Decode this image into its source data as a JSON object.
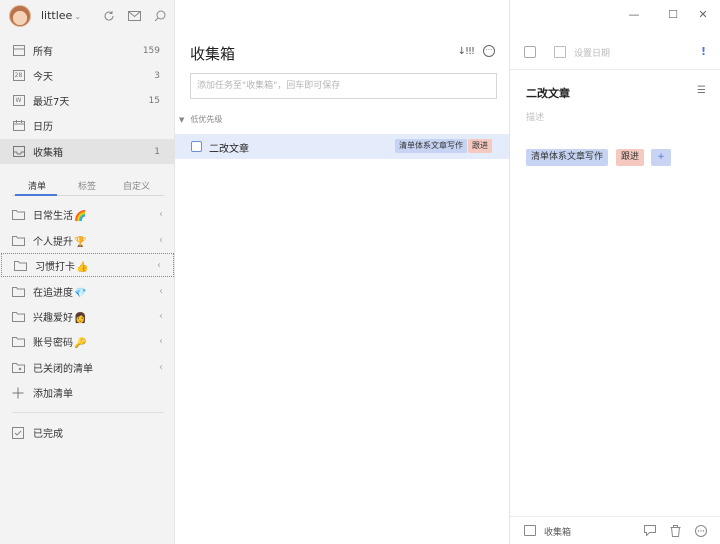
{
  "user": {
    "name": "littlee",
    "caret": "⌄"
  },
  "sidebar": {
    "nav": [
      {
        "label": "所有",
        "count": "159",
        "icon": "inbox-tray-icon"
      },
      {
        "label": "今天",
        "count": "3",
        "icon": "calendar-28-icon",
        "icon_text": "28"
      },
      {
        "label": "最近7天",
        "count": "15",
        "icon": "calendar-week-icon",
        "icon_text": "W"
      },
      {
        "label": "日历",
        "count": "",
        "icon": "calendar-icon"
      },
      {
        "label": "收集箱",
        "count": "1",
        "icon": "inbox-icon",
        "active": true
      }
    ],
    "tabs": [
      "清单",
      "标签",
      "自定义"
    ],
    "lists": [
      {
        "label": "日常生活",
        "emoji": "🌈"
      },
      {
        "label": "个人提升",
        "emoji": "🏆"
      },
      {
        "label": "习惯打卡",
        "emoji": "👍"
      },
      {
        "label": "在追进度",
        "emoji": "💎"
      },
      {
        "label": "兴趣爱好",
        "emoji": "👩"
      },
      {
        "label": "账号密码",
        "emoji": "🔑"
      }
    ],
    "closed_lists": "已关闭的清单",
    "add_list": "添加清单",
    "completed": "已完成",
    "chevron": "‹"
  },
  "middle": {
    "title": "收集箱",
    "sort_label": "↓!!!",
    "more_label": "···",
    "add_placeholder": "添加任务至\"收集箱\"，回车即可保存",
    "section_title": "低优先级",
    "section_toggle": "▼",
    "tasks": [
      {
        "title": "二改文章",
        "tags": [
          "清单体系文章写作",
          "跟进"
        ]
      }
    ]
  },
  "detail": {
    "date_placeholder": "设置日期",
    "priority_mark": "!",
    "title": "二改文章",
    "menu_icon": "☰",
    "description_placeholder": "描述",
    "tags": [
      "清单体系文章写作",
      "跟进"
    ],
    "add_tag": "+",
    "list_name": "收集箱"
  },
  "window": {
    "minimize": "—",
    "maximize": "☐",
    "close": "✕"
  },
  "colors": {
    "accent": "#4a78d8",
    "selected_row": "#e4ebfa",
    "tag_blue": "#c6d3f3",
    "tag_salmon": "#f5c9c0",
    "sidebar_bg": "#f3f3f3"
  }
}
